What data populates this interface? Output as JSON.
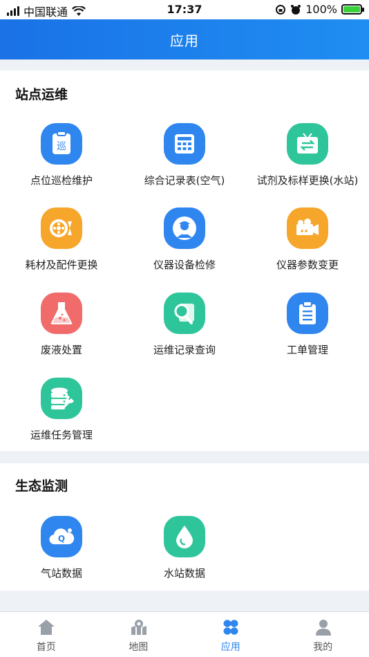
{
  "status_bar": {
    "carrier": "中国联通",
    "time": "17:37",
    "battery": "100%"
  },
  "header": {
    "title": "应用"
  },
  "sections": [
    {
      "title": "站点运维",
      "items": [
        {
          "label": "点位巡检维护",
          "icon": "inspection-icon",
          "color": "#2f86ee"
        },
        {
          "label": "综合记录表(空气)",
          "icon": "keypad-icon",
          "color": "#2f86ee"
        },
        {
          "label": "试剂及标样更换(水站)",
          "icon": "exchange-tv-icon",
          "color": "#2fc59a"
        },
        {
          "label": "耗材及配件更换",
          "icon": "film-reel-icon",
          "color": "#f6a62a"
        },
        {
          "label": "仪器设备检修",
          "icon": "technician-icon",
          "color": "#2f86ee"
        },
        {
          "label": "仪器参数变更",
          "icon": "camera-icon",
          "color": "#f6a62a"
        },
        {
          "label": "废液处置",
          "icon": "flask-icon",
          "color": "#f26b6b"
        },
        {
          "label": "运维记录查询",
          "icon": "magnifier-icon",
          "color": "#2fc59a"
        },
        {
          "label": "工单管理",
          "icon": "clipboard-icon",
          "color": "#2f86ee"
        },
        {
          "label": "运维任务管理",
          "icon": "database-wrench-icon",
          "color": "#2fc59a"
        }
      ]
    },
    {
      "title": "生态监测",
      "items": [
        {
          "label": "气站数据",
          "icon": "cloud-q-icon",
          "color": "#2f86ee"
        },
        {
          "label": "水站数据",
          "icon": "water-drop-icon",
          "color": "#2fc59a"
        }
      ]
    }
  ],
  "tabbar": {
    "active": "应用",
    "items": [
      {
        "label": "首页",
        "icon": "home-icon"
      },
      {
        "label": "地图",
        "icon": "map-icon"
      },
      {
        "label": "应用",
        "icon": "apps-icon"
      },
      {
        "label": "我的",
        "icon": "user-icon"
      }
    ]
  }
}
